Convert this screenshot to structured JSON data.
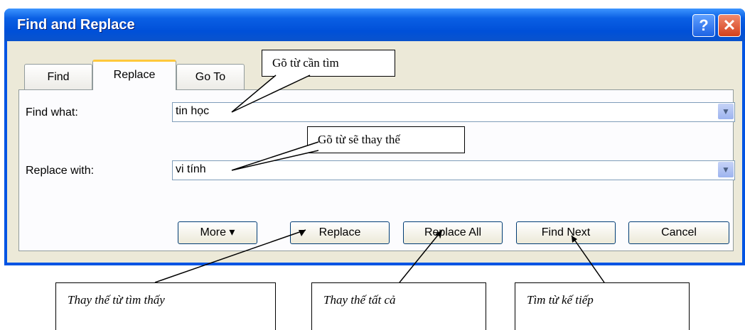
{
  "window": {
    "title": "Find and Replace"
  },
  "tabs": [
    {
      "label": "Find"
    },
    {
      "label": "Replace"
    },
    {
      "label": "Go To"
    }
  ],
  "fields": {
    "find_label": "Find what:",
    "find_value": "tin học",
    "replace_label": "Replace with:",
    "replace_value": "vi tính"
  },
  "buttons": {
    "more": "More  ▾",
    "replace": "Replace",
    "replace_all": "Replace All",
    "find_next": "Find Next",
    "cancel": "Cancel"
  },
  "callouts": {
    "find": "Gõ từ cần tìm",
    "replace": "Gõ từ sẽ thay thế"
  },
  "notes": {
    "replace": "Thay thế từ tìm thấy",
    "replace_all": "Thay thế  tất cả",
    "find_next": "Tìm từ kế tiếp"
  }
}
